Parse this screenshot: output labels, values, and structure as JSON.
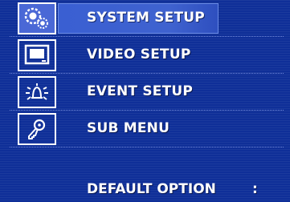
{
  "menu": {
    "items": [
      {
        "label": "SYSTEM SETUP",
        "icon": "system-gears-icon",
        "selected": true
      },
      {
        "label": "VIDEO SETUP",
        "icon": "monitor-icon",
        "selected": false
      },
      {
        "label": "EVENT SETUP",
        "icon": "alarm-bell-icon",
        "selected": false
      },
      {
        "label": "SUB MENU",
        "icon": "key-icon",
        "selected": false
      }
    ],
    "default_option": {
      "label": "DEFAULT OPTION",
      "separator": ":"
    }
  },
  "colors": {
    "background": "#0f2f98",
    "highlight": "#3f62cf",
    "text": "#ffffff",
    "divider": "#6f86d8"
  }
}
